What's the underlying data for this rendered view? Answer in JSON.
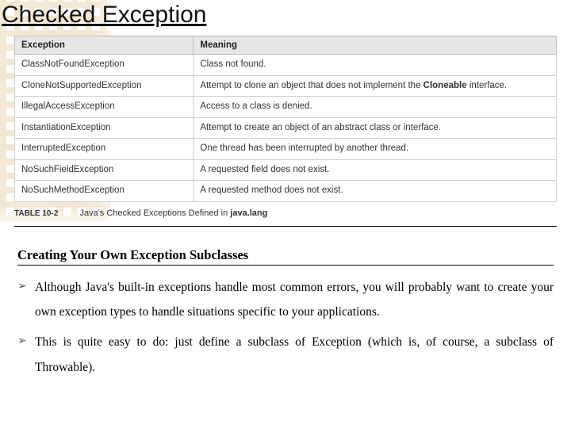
{
  "title": "Checked Exception",
  "table": {
    "headers": [
      "Exception",
      "Meaning"
    ],
    "rows": [
      {
        "name": "ClassNotFoundException",
        "meaning_pre": "Class not found.",
        "bold": "",
        "meaning_post": ""
      },
      {
        "name": "CloneNotSupportedException",
        "meaning_pre": "Attempt to clone an object that does not implement the ",
        "bold": "Cloneable",
        "meaning_post": " interface."
      },
      {
        "name": "IllegalAccessException",
        "meaning_pre": "Access to a class is denied.",
        "bold": "",
        "meaning_post": ""
      },
      {
        "name": "InstantiationException",
        "meaning_pre": "Attempt to create an object of an abstract class or interface.",
        "bold": "",
        "meaning_post": ""
      },
      {
        "name": "InterruptedException",
        "meaning_pre": "One thread has been interrupted by another thread.",
        "bold": "",
        "meaning_post": ""
      },
      {
        "name": "NoSuchFieldException",
        "meaning_pre": "A requested field does not exist.",
        "bold": "",
        "meaning_post": ""
      },
      {
        "name": "NoSuchMethodException",
        "meaning_pre": "A requested method does not exist.",
        "bold": "",
        "meaning_post": ""
      }
    ]
  },
  "caption": {
    "label": "TABLE 10-2",
    "text_pre": "Java's Checked Exceptions Defined in ",
    "text_bold": "java.lang"
  },
  "section": {
    "heading": "Creating Your Own Exception Subclasses",
    "bullets": [
      "Although Java's built-in exceptions handle most common errors, you will probably want to create your own exception types to handle situations specific to your applications.",
      "This is quite easy to do: just define a subclass of Exception (which is, of course, a subclass of Throwable)."
    ]
  }
}
